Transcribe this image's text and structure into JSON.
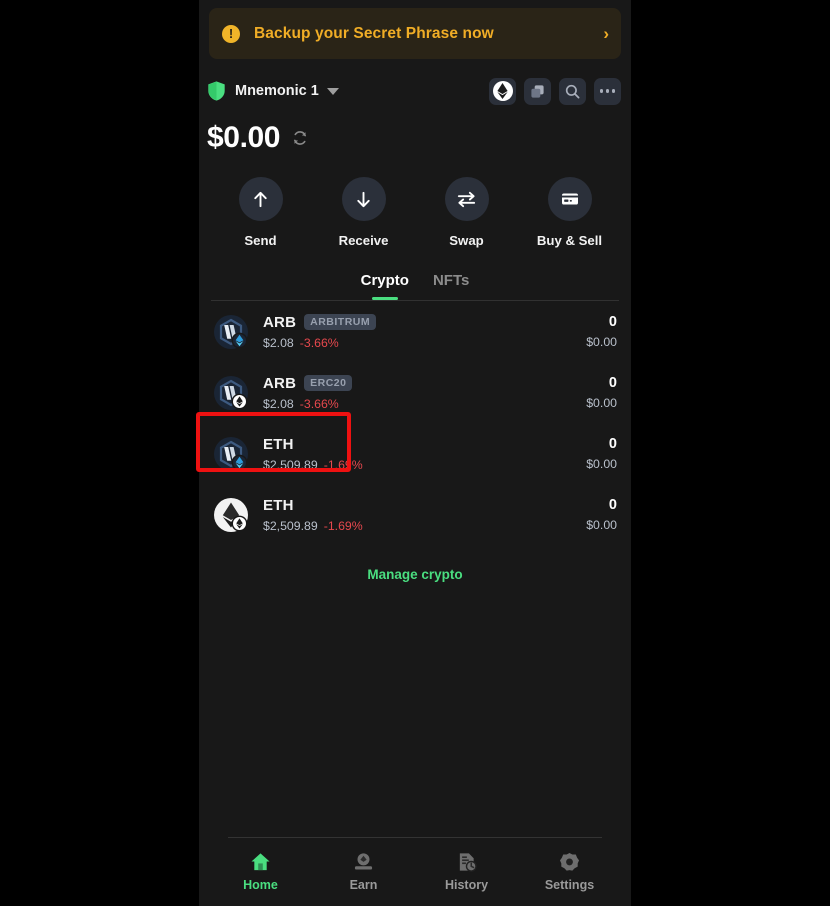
{
  "banner": {
    "icon": "alert-icon",
    "text": "Backup your Secret Phrase now",
    "chevron": "›"
  },
  "account": {
    "shield_icon": "shield-icon",
    "name": "Mnemonic 1",
    "caret_icon": "chevron-down-icon",
    "header_buttons": [
      {
        "name": "ethereum-network-button",
        "icon": "ethereum-icon"
      },
      {
        "name": "copy-address-button",
        "icon": "copy-icon"
      },
      {
        "name": "search-button",
        "icon": "search-icon"
      },
      {
        "name": "more-options-button",
        "icon": "more-dots-icon"
      }
    ]
  },
  "balance": {
    "amount": "$0.00",
    "refresh_icon": "refresh-icon"
  },
  "actions": [
    {
      "label": "Send",
      "icon": "arrow-up-icon"
    },
    {
      "label": "Receive",
      "icon": "arrow-down-icon"
    },
    {
      "label": "Swap",
      "icon": "swap-arrows-icon"
    },
    {
      "label": "Buy & Sell",
      "icon": "credit-card-icon"
    }
  ],
  "tabs": [
    {
      "label": "Crypto",
      "active": true
    },
    {
      "label": "NFTs",
      "active": false
    }
  ],
  "tokens": [
    {
      "icon": "arbitrum-token-icon",
      "symbol": "ARB",
      "chip": "ARBITRUM",
      "price": "$2.08",
      "change": "-3.66%",
      "amount": "0",
      "value": "$0.00"
    },
    {
      "icon": "arbitrum-token-icon",
      "symbol": "ARB",
      "chip": "ERC20",
      "price": "$2.08",
      "change": "-3.66%",
      "amount": "0",
      "value": "$0.00"
    },
    {
      "icon": "arbitrum-token-icon",
      "symbol": "ETH",
      "chip": "",
      "price": "$2,509.89",
      "change": "-1.69%",
      "amount": "0",
      "value": "$0.00"
    },
    {
      "icon": "ethereum-token-icon",
      "symbol": "ETH",
      "chip": "",
      "price": "$2,509.89",
      "change": "-1.69%",
      "amount": "0",
      "value": "$0.00"
    }
  ],
  "manage_crypto": "Manage crypto",
  "bottom_nav": [
    {
      "label": "Home",
      "icon": "home-icon",
      "active": true
    },
    {
      "label": "Earn",
      "icon": "earn-icon",
      "active": false
    },
    {
      "label": "History",
      "icon": "history-icon",
      "active": false
    },
    {
      "label": "Settings",
      "icon": "settings-gear-icon",
      "active": false
    }
  ],
  "colors": {
    "accent_green": "#4ade80",
    "warning_amber": "#f0ad26",
    "negative_red": "#e5484d",
    "highlight_red": "#ee1111",
    "app_background": "#181818",
    "chip_background": "#3c4452"
  },
  "highlight": {
    "target": "token-row-eth-arbitrum",
    "color": "#ee1111"
  }
}
